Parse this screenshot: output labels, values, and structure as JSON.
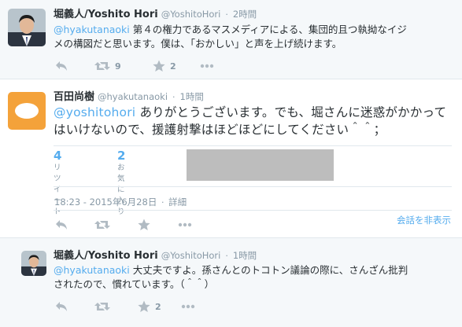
{
  "tweet1": {
    "fullname": "堀義人/Yoshito Hori",
    "username": "@YoshitoHori",
    "time": "2時間",
    "mention": "@hyakutanaoki",
    "line1": " 第４の権力であるマスメディアによる、集団的且つ執拗なイジ",
    "line2": "メの構図だと思います。僕は、「おかしい」と声を上げ続けます。",
    "retweet_count": "9",
    "favorite_count": "2"
  },
  "tweet2": {
    "fullname": "百田尚樹",
    "username": "@hyakutanaoki",
    "time": "1時間",
    "mention": "@yoshitohori",
    "line1": " ありがとうございます。でも、堀さんに迷惑がかかって",
    "line2": "はいけないので、援護射撃はほどほどにしてください＾＾；",
    "retweets_num": "4",
    "retweets_label": "リツイート",
    "favorites_num": "2",
    "favorites_label": "お気に入り",
    "timestamp": "18:23 - 2015年6月28日",
    "details": "詳細",
    "hide_conversation": "会話を非表示"
  },
  "tweet3": {
    "fullname": "堀義人/Yoshito Hori",
    "username": "@YoshitoHori",
    "time": "1時間",
    "mention": "@hyakutanaoki",
    "line1": " 大丈夫ですよ。孫さんとのトコトン議論の際に、さんざん批判",
    "line2": "されたので、慣れています。（＾＾）",
    "favorite_count": "2"
  },
  "icons": [
    "reply-icon",
    "retweet-icon",
    "favorite-icon",
    "more-icon"
  ],
  "colors": {
    "link": "#55acee",
    "muted": "#8899a6",
    "icon": "#b1bbc3",
    "background": "#f5f8fa",
    "avatar_orange": "#f4a23a"
  }
}
